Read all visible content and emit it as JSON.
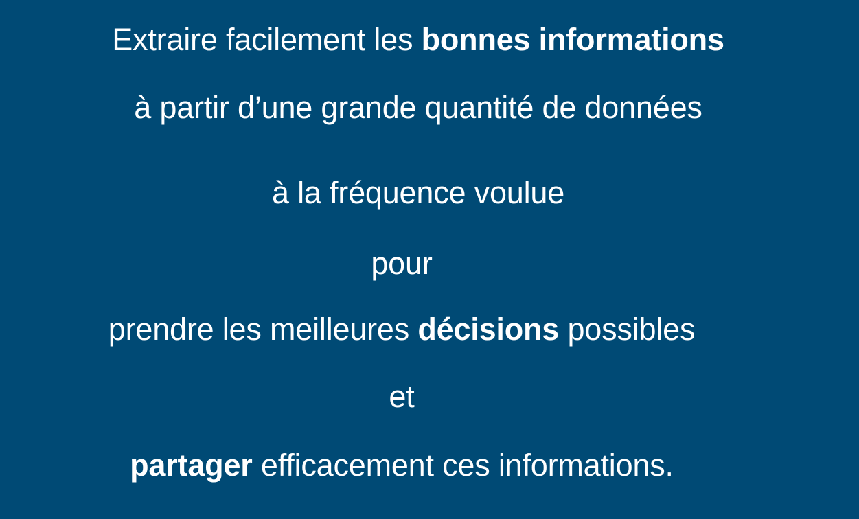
{
  "slide": {
    "background_color": "#004a75",
    "text_color": "#ffffff",
    "lines": [
      {
        "pre": "Extraire facilement les ",
        "bold": "bonnes informations",
        "post": ""
      },
      {
        "pre": "à partir d’une grande quantité de données",
        "bold": "",
        "post": ""
      },
      {
        "pre": "à la fréquence voulue",
        "bold": "",
        "post": ""
      },
      {
        "pre": "pour",
        "bold": "",
        "post": ""
      },
      {
        "pre": "prendre les meilleures ",
        "bold": "décisions",
        "post": " possibles"
      },
      {
        "pre": "et",
        "bold": "",
        "post": ""
      },
      {
        "pre": "",
        "bold": "partager",
        "post": " efficacement ces informations."
      }
    ]
  }
}
